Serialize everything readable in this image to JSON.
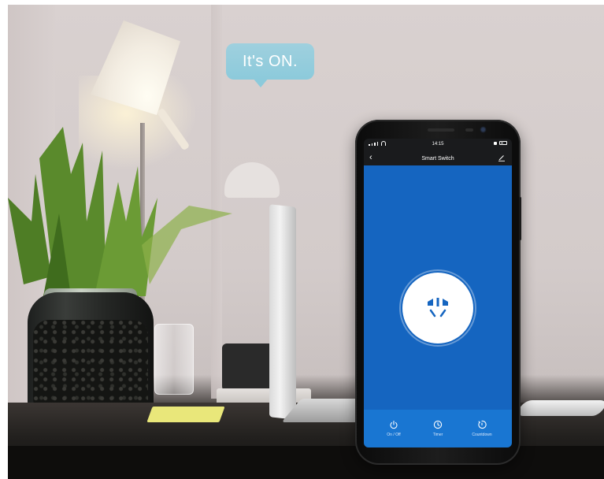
{
  "overlay": {
    "bubble_text": "It's ON."
  },
  "phone": {
    "status_bar": {
      "time": "14:15"
    },
    "nav": {
      "title": "Smart Switch",
      "back_icon": "chevron-left-icon",
      "edit_icon": "pencil-icon"
    },
    "device": {
      "power_state": "on",
      "icon": "power-socket-icon"
    },
    "bottom_tabs": [
      {
        "label": "On / Off",
        "icon": "power-icon"
      },
      {
        "label": "Timer",
        "icon": "clock-icon"
      },
      {
        "label": "Countdown",
        "icon": "countdown-icon"
      }
    ]
  },
  "colors": {
    "screen_blue": "#1565c0",
    "tab_bar_blue": "#1976d2",
    "bubble": "#8ccadb"
  }
}
